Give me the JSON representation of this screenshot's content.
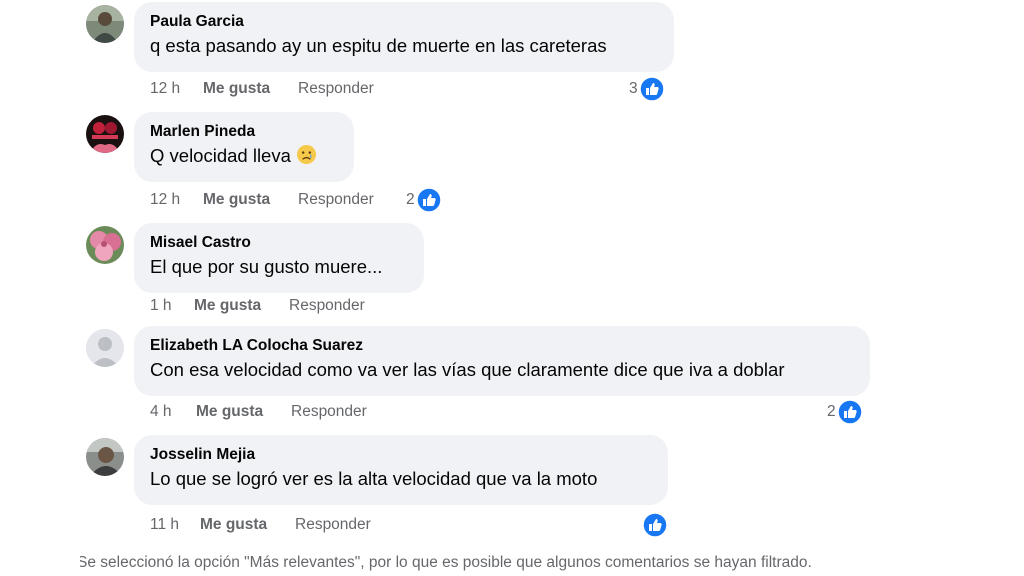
{
  "comments": [
    {
      "author": "Paula Garcia",
      "text": "q esta pasando ay un espitu de muerte en las careteras",
      "time": "12 h",
      "like_label": "Me gusta",
      "reply_label": "Responder",
      "reaction_count": "3",
      "reaction_icon": "like-icon",
      "avatar": "person-photo-avatar"
    },
    {
      "author": "Marlen Pineda",
      "text": "Q velocidad lleva",
      "emoji": "sad-face-emoji",
      "time": "12 h",
      "like_label": "Me gusta",
      "reply_label": "Responder",
      "reaction_count": "2",
      "reaction_icon": "like-icon",
      "avatar": "dark-red-photo-avatar"
    },
    {
      "author": "Misael Castro",
      "text": "El que por su gusto muere...",
      "time": "1 h",
      "like_label": "Me gusta",
      "reply_label": "Responder",
      "avatar": "pink-flowers-avatar"
    },
    {
      "author": "Elizabeth LA Colocha Suarez",
      "text": "Con esa velocidad como va ver las vías que claramente dice que iva a doblar",
      "time": "4 h",
      "like_label": "Me gusta",
      "reply_label": "Responder",
      "reaction_count": "2",
      "reaction_icon": "like-icon",
      "avatar": "default-silhouette-avatar"
    },
    {
      "author": "Josselin Mejia",
      "text": "Lo que se logró ver es la alta velocidad que va la moto",
      "time": "11 h",
      "like_label": "Me gusta",
      "reply_label": "Responder",
      "reaction_count": "",
      "reaction_icon": "like-icon",
      "avatar": "person-photo-avatar"
    }
  ],
  "footer_note": "Se seleccionó la opción \"Más relevantes\", por lo que es posible que algunos comentarios se hayan filtrado.",
  "colors": {
    "bubble_bg": "#f0f2f5",
    "secondary_text": "#65676b",
    "like_blue": "#1877f2"
  }
}
